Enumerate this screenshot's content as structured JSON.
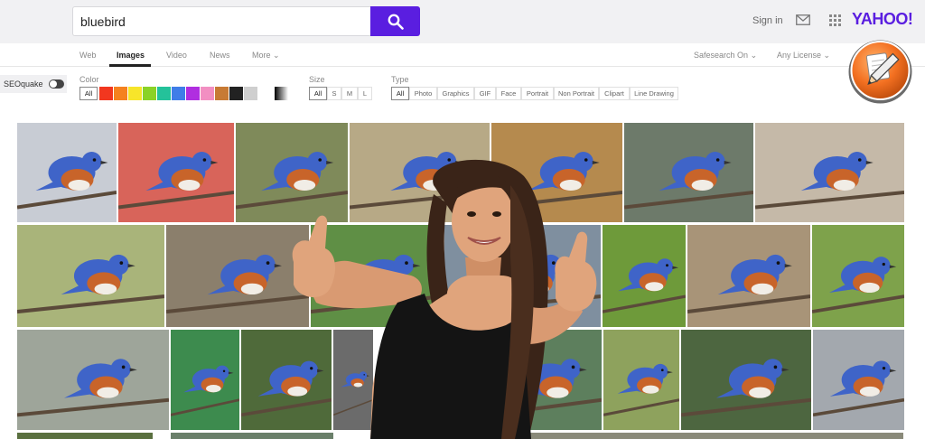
{
  "search": {
    "query": "bluebird"
  },
  "header": {
    "signin_label": "Sign in",
    "logo_text": "YAHOO!"
  },
  "nav": {
    "tabs": [
      {
        "label": "Web"
      },
      {
        "label": "Images"
      },
      {
        "label": "Video"
      },
      {
        "label": "News"
      },
      {
        "label": "More"
      }
    ],
    "safesearch_label": "Safesearch On",
    "license_label": "Any License"
  },
  "filters": {
    "seoquake_label": "SEOquake",
    "color_label": "Color",
    "color_all": "All",
    "swatches": [
      "#f2371f",
      "#f5821f",
      "#f7e52a",
      "#8bd226",
      "#24c29a",
      "#3f7de8",
      "#b02ee0",
      "#f28fc2",
      "#c77a34",
      "#222222",
      "#cfcfcf"
    ],
    "size_label": "Size",
    "sizes": [
      "All",
      "S",
      "M",
      "L"
    ],
    "type_label": "Type",
    "types": [
      "All",
      "Photo",
      "Graphics",
      "GIF",
      "Face",
      "Portrait",
      "Non Portrait",
      "Clipart",
      "Line Drawing"
    ]
  },
  "colors": {
    "accent": "#5a1ee0",
    "bird_blue": "#3f64c8",
    "bird_orange": "#c8642a"
  },
  "icons": [
    "search-icon",
    "mail-icon",
    "apps-icon",
    "chevron-down-icon",
    "pencil-icon"
  ]
}
